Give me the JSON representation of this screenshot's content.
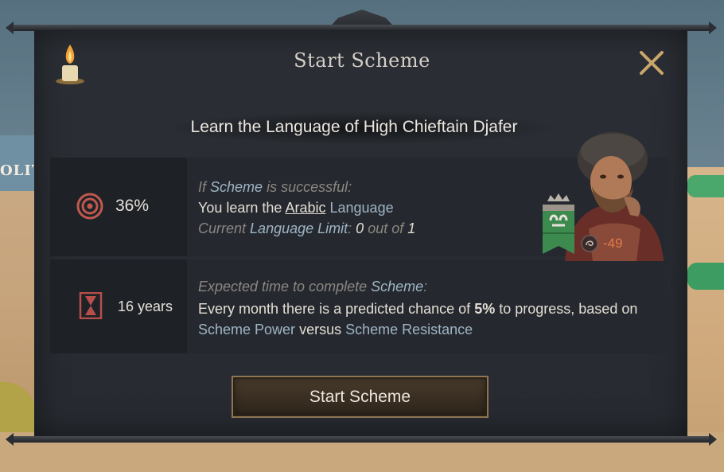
{
  "map": {
    "label_fragment": "OLIT"
  },
  "dialog": {
    "title": "Start Scheme",
    "scheme_name": "Learn the Language of High Chieftain Djafer",
    "success": {
      "chance": "36%",
      "heading_prefix": "If",
      "heading_link": "Scheme",
      "heading_suffix": "is successful:",
      "line1_prefix": "You learn the",
      "line1_language": "Arabic",
      "line1_suffix": "Language",
      "line2_prefix": "Current",
      "line2_link": "Language Limit",
      "line2_colon": ":",
      "line2_current": "0",
      "line2_mid": "out of",
      "line2_max": "1"
    },
    "time": {
      "duration": "16 years",
      "heading_prefix": "Expected time to complete",
      "heading_link": "Scheme",
      "heading_suffix": ":",
      "line1_prefix": "Every month there is a predicted chance of",
      "line1_value": "5%",
      "line1_suffix": "to progress, based on",
      "line2_link1": "Scheme Power",
      "line2_mid": "versus",
      "line2_link2": "Scheme Resistance"
    },
    "target": {
      "opinion": "-49"
    },
    "confirm_button": "Start Scheme"
  },
  "colors": {
    "panel_bg": "#2b2f35",
    "row_bg": "#25292f",
    "link_blue": "#9fb4c4",
    "opinion_negative": "#e07a4a",
    "button_border": "#8d7552",
    "close_gold": "#c9a66b",
    "banner_green": "#3d8a4f"
  },
  "icons": {
    "candle": "candle-icon",
    "close": "close-icon",
    "chance": "target-icon",
    "time": "hourglass-icon",
    "opinion": "opinion-icon",
    "coat_of_arms": "coat-of-arms-icon"
  }
}
